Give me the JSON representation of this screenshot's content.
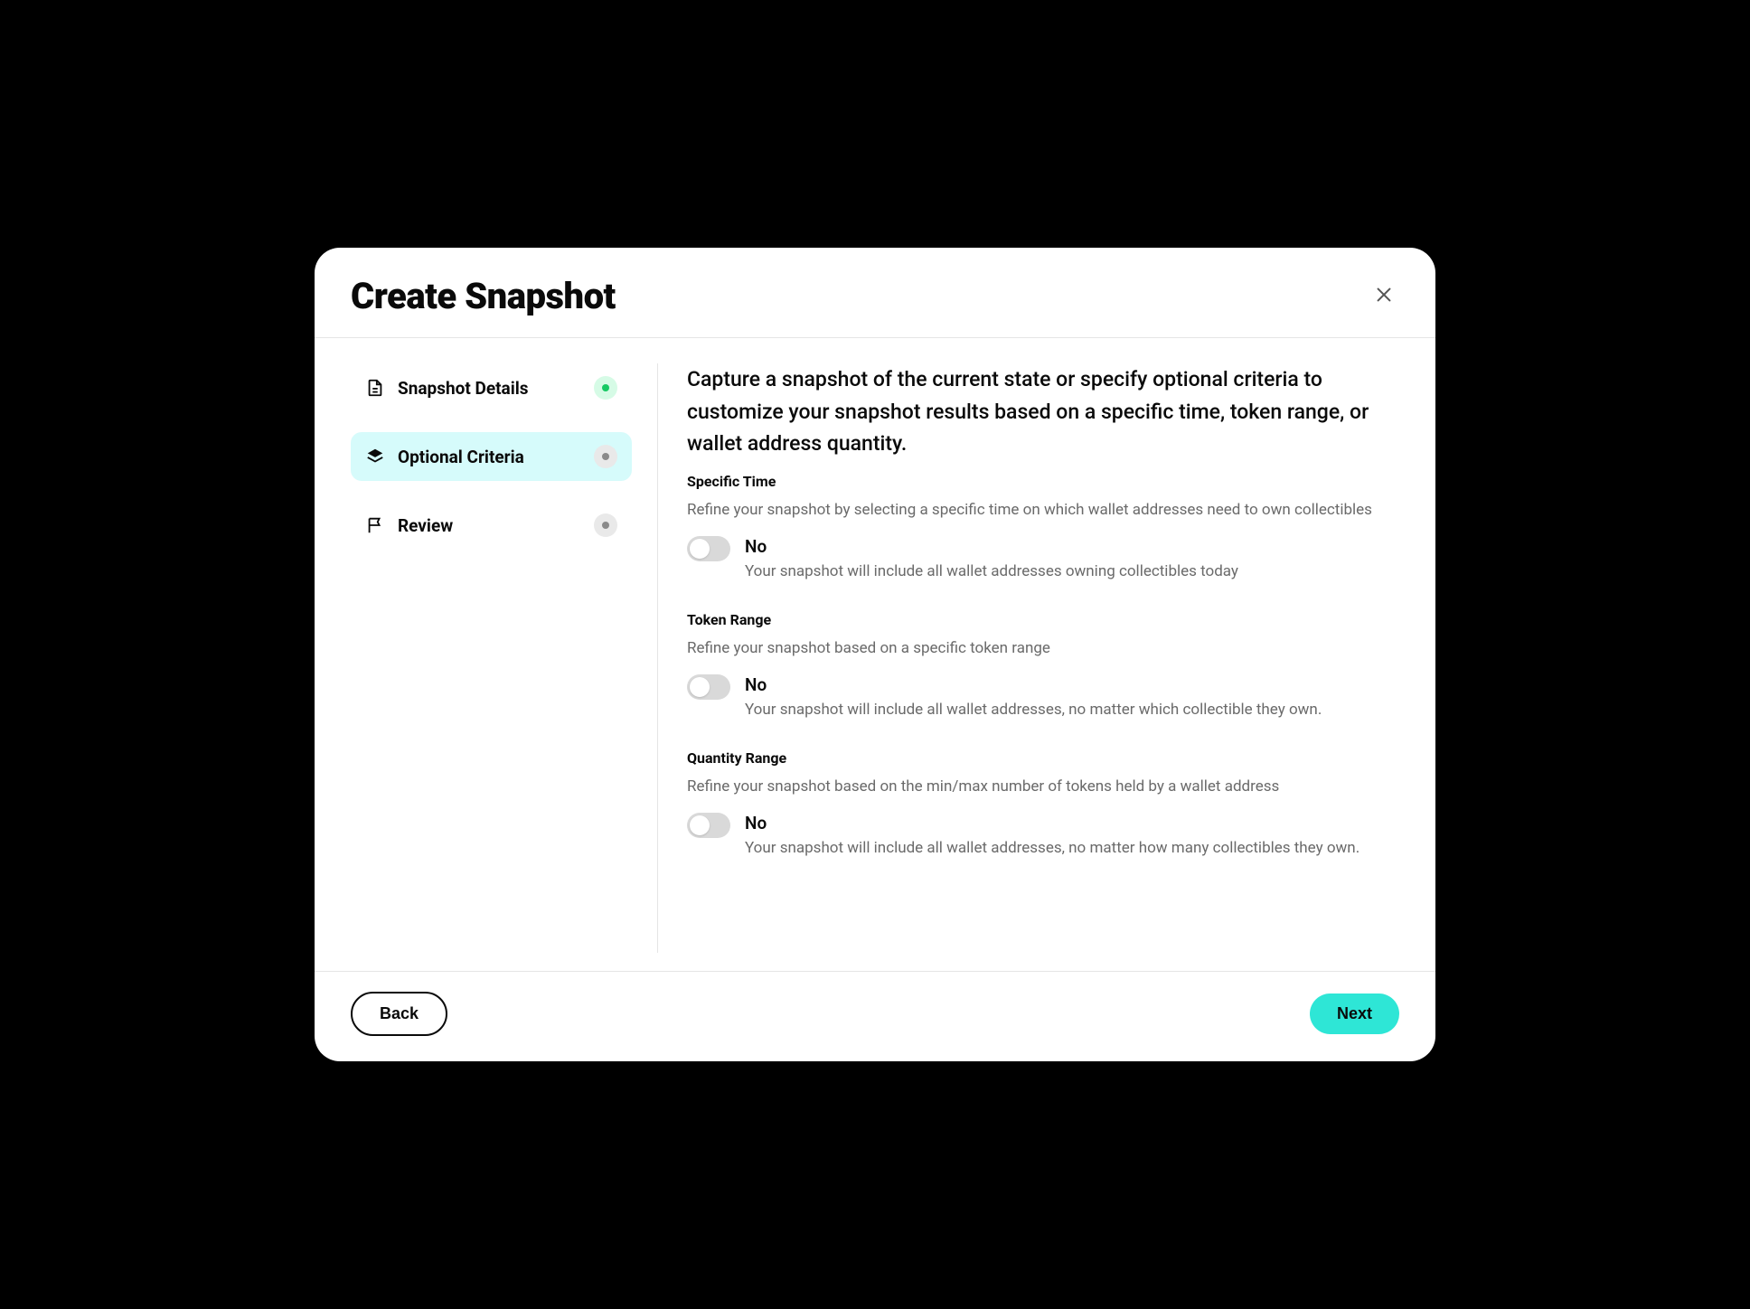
{
  "header": {
    "title": "Create Snapshot"
  },
  "sidebar": {
    "steps": [
      {
        "label": "Snapshot Details"
      },
      {
        "label": "Optional Criteria"
      },
      {
        "label": "Review"
      }
    ]
  },
  "content": {
    "intro": "Capture a snapshot of the current state or specify optional criteria to customize your snapshot results based on a specific time, token range, or wallet address quantity.",
    "sections": [
      {
        "title": "Specific Time",
        "desc": "Refine your snapshot by selecting a specific time on which wallet addresses need to own collectibles",
        "toggle_label": "No",
        "toggle_hint": "Your snapshot will include all wallet addresses owning collectibles today"
      },
      {
        "title": "Token Range",
        "desc": "Refine your snapshot based on a specific token range",
        "toggle_label": "No",
        "toggle_hint": "Your snapshot will include all wallet addresses, no matter which collectible they own."
      },
      {
        "title": "Quantity Range",
        "desc": "Refine your snapshot based on the min/max number of tokens held by a wallet address",
        "toggle_label": "No",
        "toggle_hint": "Your snapshot will include all wallet addresses, no matter how many collectibles they own."
      }
    ]
  },
  "footer": {
    "back": "Back",
    "next": "Next"
  }
}
